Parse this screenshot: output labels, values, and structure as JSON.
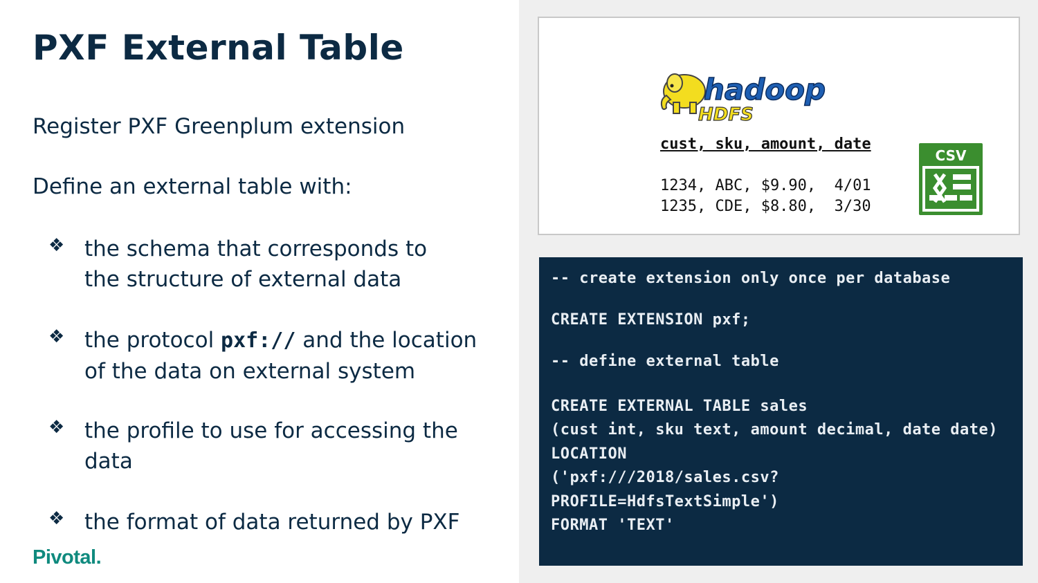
{
  "slide": {
    "title": "PXF External Table",
    "para1": "Register PXF Greenplum extension",
    "para2": "Define an external table with:",
    "bullets": [
      {
        "mark": "❖",
        "line1": "the schema that corresponds to",
        "line2": "the structure of external data"
      },
      {
        "mark": "❖",
        "pre": "the protocol ",
        "code": "pxf://",
        "post": " and the location",
        "line2": "of the data on external system"
      },
      {
        "mark": "❖",
        "line1": "the profile to use for accessing the",
        "line2": "data"
      },
      {
        "mark": "❖",
        "line1": "the format of data returned by PXF"
      }
    ],
    "brand": "Pivotal."
  },
  "data_panel": {
    "logo": {
      "icon": "hadoop-elephant-logo",
      "word": "hadoop",
      "sub": "HDFS"
    },
    "header": "cust, sku, amount, date",
    "rows": [
      "1234, ABC, $9.90,  4/01",
      "1235, CDE, $8.80,  3/30"
    ],
    "csv_icon": {
      "icon": "csv-file-icon",
      "label": "CSV",
      "color": "#3b8e2f"
    }
  },
  "code_panel": {
    "background": "#0c2a43",
    "lines": [
      "-- create extension only once per database",
      "CREATE EXTENSION pxf;",
      "-- define external table",
      "CREATE EXTERNAL TABLE sales",
      "(cust int, sku text, amount decimal, date date)",
      "LOCATION",
      "('pxf:///2018/sales.csv?",
      "PROFILE=HdfsTextSimple')",
      "FORMAT 'TEXT'"
    ]
  }
}
